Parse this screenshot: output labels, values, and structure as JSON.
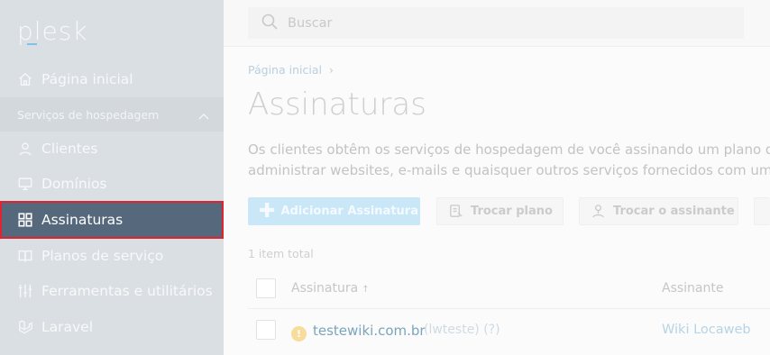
{
  "app": {
    "logo_text": "plesk"
  },
  "sidebar": {
    "home": "Página inicial",
    "group_label": "Serviços de hospedagem",
    "items": [
      {
        "label": "Clientes",
        "icon": "user-icon"
      },
      {
        "label": "Domínios",
        "icon": "monitor-icon"
      },
      {
        "label": "Assinaturas",
        "icon": "grid-icon",
        "active": true
      },
      {
        "label": "Planos de serviço",
        "icon": "book-icon"
      },
      {
        "label": "Ferramentas e utilitários",
        "icon": "tools-icon"
      },
      {
        "label": "Laravel",
        "icon": "laravel-icon"
      }
    ]
  },
  "search": {
    "placeholder": "Buscar"
  },
  "breadcrumb": {
    "home": "Página inicial",
    "separator": "›"
  },
  "page": {
    "title": "Assinaturas",
    "description_line1": "Os clientes obtêm os serviços de hospedagem de você assinando um plano de ho",
    "description_line2": "administrar websites, e-mails e quaisquer outros serviços fornecidos com uma as"
  },
  "toolbar": {
    "add_label": "Adicionar Assinatura",
    "change_plan_label": "Trocar plano",
    "change_subscriber_label": "Trocar o assinante"
  },
  "list": {
    "count_text": "1 item total",
    "columns": {
      "subscription": "Assinatura",
      "subscription_sort": "↑",
      "subscriber": "Assinante"
    },
    "rows": [
      {
        "warning": "!",
        "domain": "testewiki.com.br",
        "meta": "(lwteste) (?)",
        "subscriber": "Wiki Locaweb"
      }
    ]
  },
  "colors": {
    "sidebar_bg": "#dadfe3",
    "active_bg": "#55687c",
    "highlight_border": "#e0232e",
    "primary_button": "#c9e7f7"
  }
}
